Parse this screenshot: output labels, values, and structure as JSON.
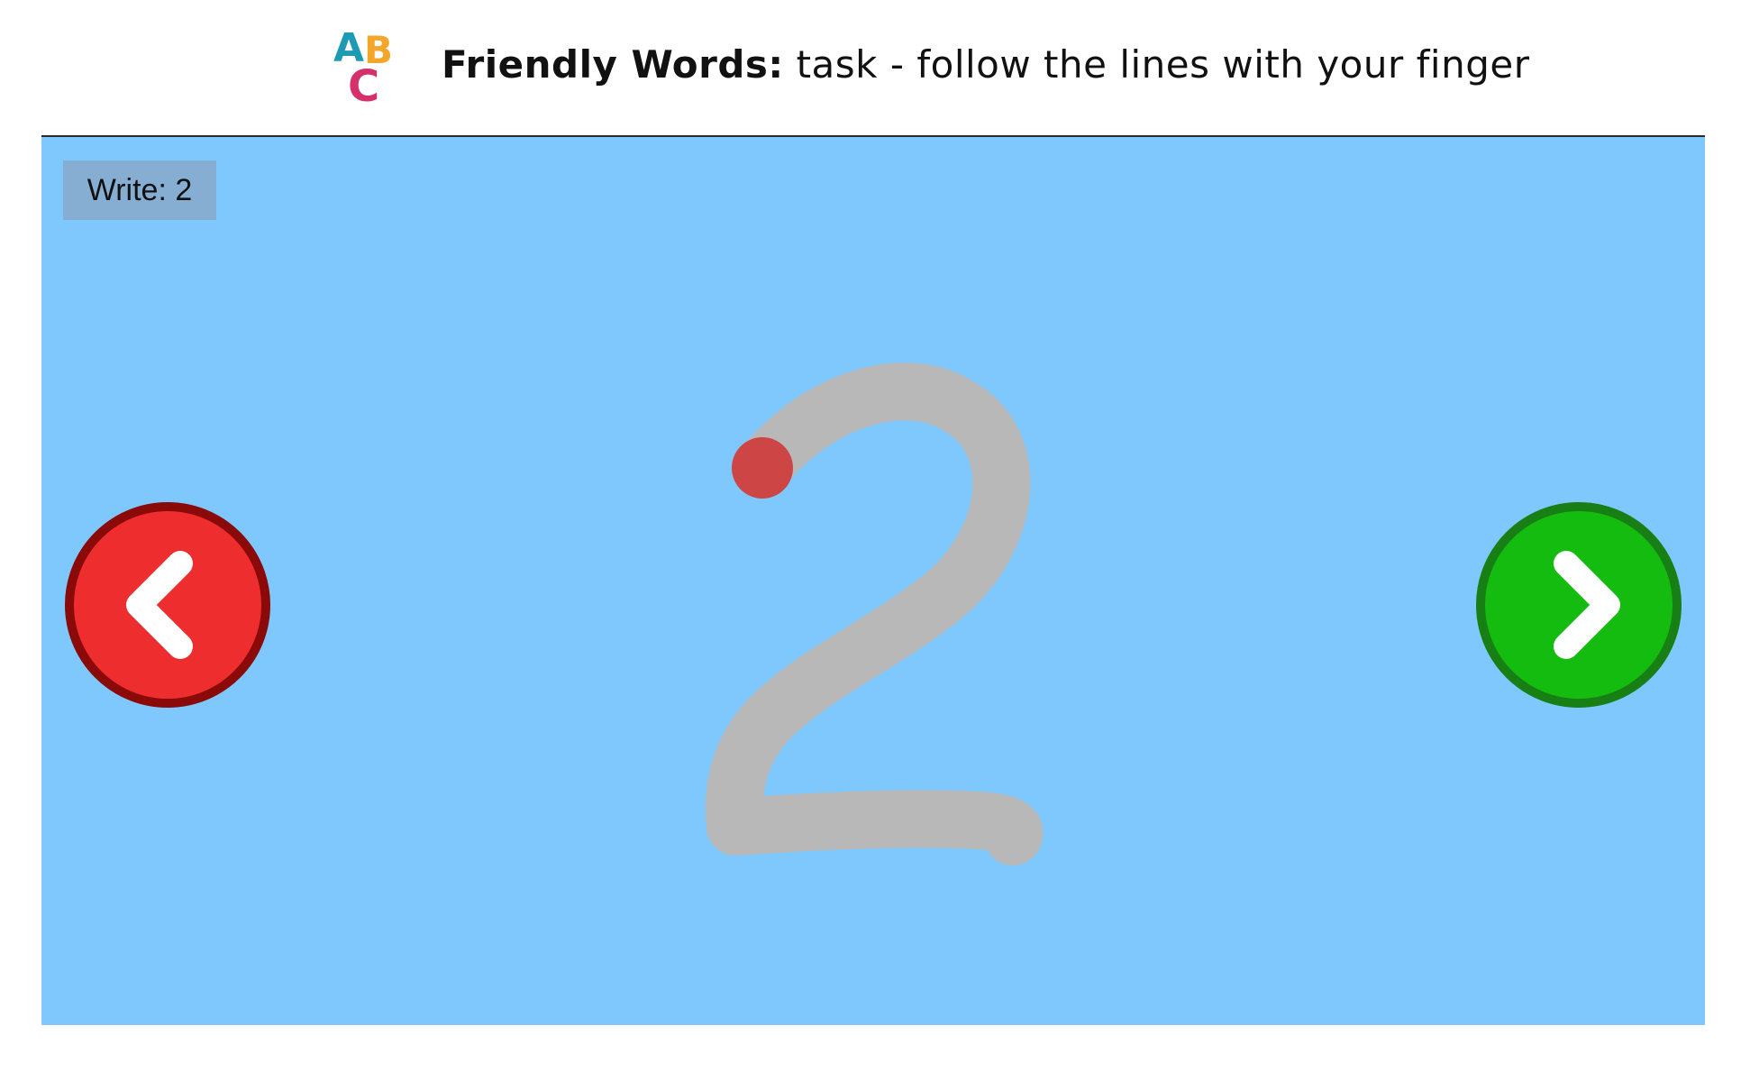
{
  "header": {
    "logo_letters": [
      "A",
      "B",
      "C"
    ],
    "app_name": "Friendly Words:",
    "task": "task - follow the lines with your finger"
  },
  "game": {
    "prompt": "Write: 2",
    "target_character": "2",
    "trace_progress": 0
  },
  "navigation": {
    "previous_icon": "chevron-left-icon",
    "next_icon": "chevron-right-icon"
  },
  "colors": {
    "stage_background": "#7ec8fe",
    "prompt_badge": "#86aed3",
    "guide_stroke": "#b8b8b8",
    "start_dot": "#cd4545",
    "previous_button": "#ee2e2e",
    "previous_border": "#8a0909",
    "next_button": "#13bc0f",
    "next_border": "#187f14"
  }
}
